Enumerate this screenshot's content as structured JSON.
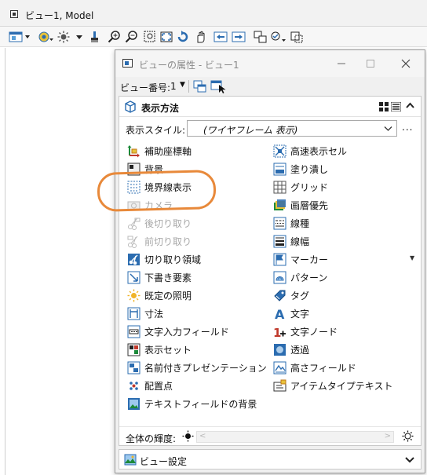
{
  "view_window": {
    "title": "ビュー1, Model"
  },
  "dialog": {
    "title": "ビューの属性 - ビュー1",
    "view_number_label": "ビュー番号:",
    "view_number_value": "1",
    "panel_title": "表示方法",
    "display_style_label": "表示スタイル:",
    "display_style_value": "(ワイヤフレーム 表示)",
    "more_button": "...",
    "left_items": [
      {
        "label": "補助座標軸",
        "icon": "aux-axis-icon",
        "enabled": true
      },
      {
        "label": "背景",
        "icon": "background-icon",
        "enabled": true
      },
      {
        "label": "境界線表示",
        "icon": "boundary-display-icon",
        "enabled": true
      },
      {
        "label": "カメラ",
        "icon": "camera-icon",
        "enabled": false
      },
      {
        "label": "後切り取り",
        "icon": "back-clip-icon",
        "enabled": false
      },
      {
        "label": "前切り取り",
        "icon": "front-clip-icon",
        "enabled": false
      },
      {
        "label": "切り取り領域",
        "icon": "clip-volume-icon",
        "enabled": true
      },
      {
        "label": "下書き要素",
        "icon": "construction-element-icon",
        "enabled": true
      },
      {
        "label": "既定の照明",
        "icon": "default-lighting-icon",
        "enabled": true
      },
      {
        "label": "寸法",
        "icon": "dimension-icon",
        "enabled": true
      },
      {
        "label": "文字入力フィールド",
        "icon": "data-field-icon",
        "enabled": true
      },
      {
        "label": "表示セット",
        "icon": "display-set-icon",
        "enabled": true
      },
      {
        "label": "名前付きプレゼンテーション",
        "icon": "named-presentation-icon",
        "enabled": true
      },
      {
        "label": "配置点",
        "icon": "placement-point-icon",
        "enabled": true
      },
      {
        "label": "テキストフィールドの背景",
        "icon": "text-field-background-icon",
        "enabled": true
      }
    ],
    "right_items": [
      {
        "label": "高速表示セル",
        "icon": "fast-cells-icon",
        "enabled": true
      },
      {
        "label": "塗り潰し",
        "icon": "fill-icon",
        "enabled": true
      },
      {
        "label": "グリッド",
        "icon": "grid-icon",
        "enabled": true
      },
      {
        "label": "画層優先",
        "icon": "level-override-icon",
        "enabled": true
      },
      {
        "label": "線種",
        "icon": "line-style-icon",
        "enabled": true
      },
      {
        "label": "線幅",
        "icon": "line-weight-icon",
        "enabled": true
      },
      {
        "label": "マーカー",
        "icon": "marker-icon",
        "enabled": true,
        "has_dropdown": true
      },
      {
        "label": "パターン",
        "icon": "pattern-icon",
        "enabled": true
      },
      {
        "label": "タグ",
        "icon": "tag-icon",
        "enabled": true
      },
      {
        "label": "文字",
        "icon": "text-icon",
        "enabled": true
      },
      {
        "label": "文字ノード",
        "icon": "text-node-icon",
        "enabled": true
      },
      {
        "label": "透過",
        "icon": "transparency-icon",
        "enabled": true
      },
      {
        "label": "高さフィールド",
        "icon": "height-field-icon",
        "enabled": true
      },
      {
        "label": "アイテムタイプテキスト",
        "icon": "item-type-text-icon",
        "enabled": true
      }
    ],
    "brightness_label": "全体の輝度:",
    "footer_title": "ビュー設定"
  },
  "colors": {
    "accent_blue": "#2b6cb0",
    "highlight_orange": "#e8893a",
    "disabled_text": "#a8a8a8"
  }
}
